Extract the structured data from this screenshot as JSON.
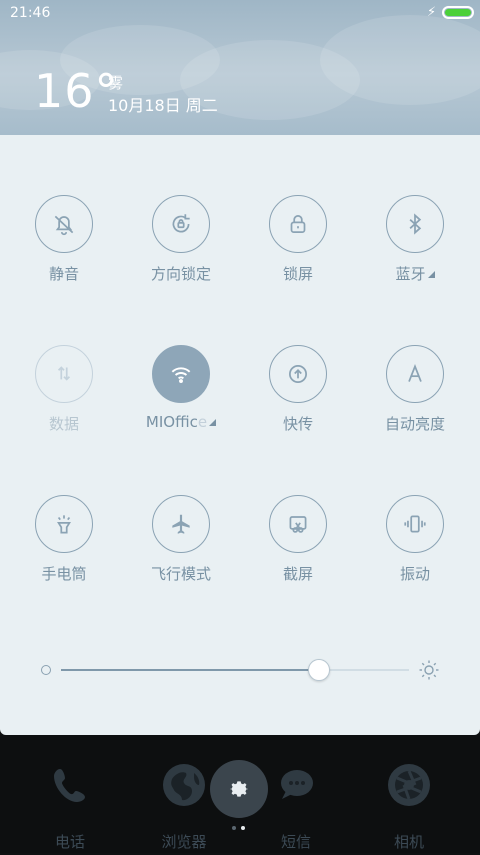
{
  "status_bar": {
    "time": "21:46"
  },
  "weather": {
    "temperature": "16°",
    "condition": "雾",
    "date": "10月18日 周二"
  },
  "quick_settings": {
    "tiles": [
      {
        "label": "静音",
        "icon": "bell-off-icon"
      },
      {
        "label": "方向锁定",
        "icon": "rotation-lock-icon"
      },
      {
        "label": "锁屏",
        "icon": "lock-icon"
      },
      {
        "label": "蓝牙",
        "icon": "bluetooth-icon"
      },
      {
        "label": "数据",
        "icon": "mobile-data-icon"
      },
      {
        "label_main": "MIOffic",
        "label_fade": "e",
        "icon": "wifi-icon"
      },
      {
        "label": "快传",
        "icon": "upload-circle-icon"
      },
      {
        "label": "自动亮度",
        "icon": "auto-brightness-icon"
      },
      {
        "label": "手电筒",
        "icon": "flashlight-icon"
      },
      {
        "label": "飞行模式",
        "icon": "airplane-icon"
      },
      {
        "label": "截屏",
        "icon": "screenshot-icon"
      },
      {
        "label": "振动",
        "icon": "vibrate-icon"
      }
    ]
  },
  "brightness": {
    "level": 0.74
  },
  "dock": [
    {
      "label": "电话",
      "icon": "phone-icon"
    },
    {
      "label": "浏览器",
      "icon": "browser-icon"
    },
    {
      "label": "短信",
      "icon": "message-icon"
    },
    {
      "label": "相机",
      "icon": "camera-icon"
    }
  ],
  "colors": {
    "accent": "#8ea6b8",
    "battery": "#4cd03a",
    "panel": "#e9f0f3"
  }
}
